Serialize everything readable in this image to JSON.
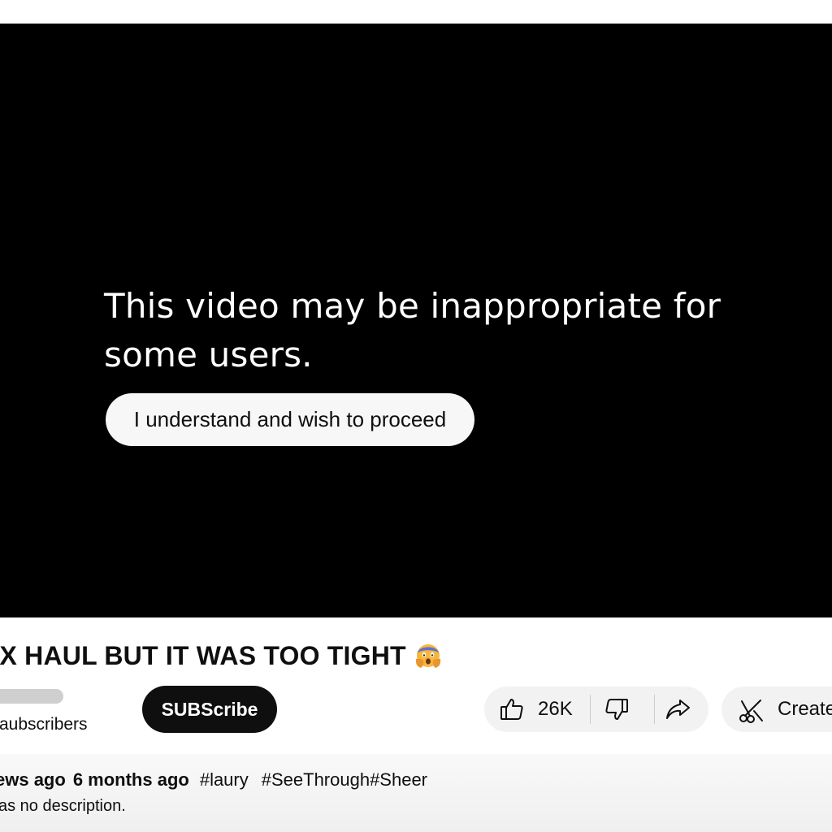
{
  "player": {
    "warning_text": "This video may be inappropriate for some users.",
    "proceed_label": "I understand and wish to proceed"
  },
  "video": {
    "title": "EX HAUL BUT IT WAS TOO TIGHT",
    "title_emoji": "face-with-hands-over-mouth-emoji"
  },
  "channel": {
    "subscribers_text": "aubscribers",
    "subscribe_label": "SUBScribe"
  },
  "actions": {
    "like_count": "26K",
    "like_icon": "thumbs-up-icon",
    "dislike_icon": "thumbs-down-icon",
    "share_icon": "share-arrow-icon",
    "create_label": "Create",
    "create_icon": "scissors-icon"
  },
  "description": {
    "views": "ews ago",
    "upload_date": "6 months ago",
    "hashtags": [
      "#laury",
      "#SeeThrough#Sheer"
    ],
    "text": "as no description."
  },
  "colors": {
    "player_background": "#000000",
    "subscribe_background": "#0f0f0f",
    "pill_background": "#f2f2f2",
    "text": "#0f0f0f"
  }
}
